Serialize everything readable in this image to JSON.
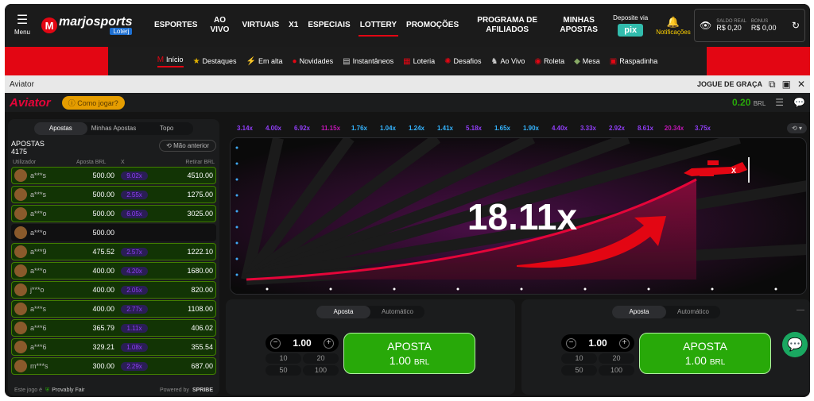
{
  "header": {
    "menu_label": "Menu",
    "logo_text": "marjosports",
    "logo_sub": "Loterj",
    "nav": [
      {
        "label": "ESPORTES"
      },
      {
        "label": "AO VIVO"
      },
      {
        "label": "VIRTUAIS"
      },
      {
        "label": "X1"
      },
      {
        "label": "ESPECIAIS"
      },
      {
        "label": "LOTTERY"
      },
      {
        "label": "PROMOÇÕES"
      },
      {
        "label": "PROGRAMA DE AFILIADOS"
      },
      {
        "label": "MINHAS APOSTAS"
      }
    ],
    "deposit_label": "Deposite via",
    "deposit_method": "pix",
    "notifications_label": "Notificações",
    "balance": {
      "real_label": "SALDO REAL",
      "real_value": "R$ 0,20",
      "bonus_label": "BONUS",
      "bonus_value": "R$ 0,00"
    }
  },
  "subnav": [
    {
      "label": "Início",
      "icon": "M"
    },
    {
      "label": "Destaques",
      "icon": "★"
    },
    {
      "label": "Em alta",
      "icon": "⚡"
    },
    {
      "label": "Novidades",
      "icon": "●"
    },
    {
      "label": "Instantâneos",
      "icon": "▤"
    },
    {
      "label": "Loteria",
      "icon": "▦"
    },
    {
      "label": "Desafios",
      "icon": "✺"
    },
    {
      "label": "Ao Vivo",
      "icon": "♞"
    },
    {
      "label": "Roleta",
      "icon": "◉"
    },
    {
      "label": "Mesa",
      "icon": "◆"
    },
    {
      "label": "Raspadinha",
      "icon": "▣"
    }
  ],
  "game_title": "Aviator",
  "play_free": "JOGUE DE GRAÇA",
  "game": {
    "logo": "Aviator",
    "how_to": "Como jogar?",
    "balance": "0.20",
    "currency": "BRL"
  },
  "bets": {
    "tabs": [
      "Apostas",
      "Minhas Apostas",
      "Topo"
    ],
    "title": "APOSTAS",
    "count": "4175",
    "prev_hand": "Mão anterior",
    "columns": [
      "Utilizador",
      "Aposta BRL",
      "X",
      "Retirar BRL"
    ],
    "rows": [
      {
        "user": "a***s",
        "bet": "500.00",
        "mult": "9.02x",
        "win": "4510.00",
        "won": true
      },
      {
        "user": "a***s",
        "bet": "500.00",
        "mult": "2.55x",
        "win": "1275.00",
        "won": true
      },
      {
        "user": "a***o",
        "bet": "500.00",
        "mult": "6.05x",
        "win": "3025.00",
        "won": true
      },
      {
        "user": "a***o",
        "bet": "500.00",
        "mult": "",
        "win": "",
        "won": false
      },
      {
        "user": "a***9",
        "bet": "475.52",
        "mult": "2.57x",
        "win": "1222.10",
        "won": true
      },
      {
        "user": "a***o",
        "bet": "400.00",
        "mult": "4.20x",
        "win": "1680.00",
        "won": true
      },
      {
        "user": "j***o",
        "bet": "400.00",
        "mult": "2.05x",
        "win": "820.00",
        "won": true
      },
      {
        "user": "a***s",
        "bet": "400.00",
        "mult": "2.77x",
        "win": "1108.00",
        "won": true
      },
      {
        "user": "a***6",
        "bet": "365.79",
        "mult": "1.11x",
        "win": "406.02",
        "won": true
      },
      {
        "user": "a***6",
        "bet": "329.21",
        "mult": "1.08x",
        "win": "355.54",
        "won": true
      },
      {
        "user": "m***s",
        "bet": "300.00",
        "mult": "2.29x",
        "win": "687.00",
        "won": true
      }
    ],
    "footer_left": "Este jogo é",
    "provably_fair": "Provably Fair",
    "powered_by": "Powered by",
    "spribe": "SPRIBE"
  },
  "history": [
    "3.14x",
    "4.00x",
    "6.92x",
    "11.15x",
    "1.76x",
    "1.04x",
    "1.24x",
    "1.41x",
    "5.18x",
    "1.65x",
    "1.90x",
    "4.40x",
    "3.33x",
    "2.92x",
    "8.61x",
    "20.34x",
    "3.75x"
  ],
  "current_multiplier": "18.11x",
  "bet_panels": [
    {
      "tabs": [
        "Aposta",
        "Automático"
      ],
      "stake": "1.00",
      "quick": [
        "10",
        "20",
        "50",
        "100"
      ],
      "btn_label": "APOSTA",
      "btn_amount": "1.00",
      "btn_currency": "BRL"
    },
    {
      "tabs": [
        "Aposta",
        "Automático"
      ],
      "stake": "1.00",
      "quick": [
        "10",
        "20",
        "50",
        "100"
      ],
      "btn_label": "APOSTA",
      "btn_amount": "1.00",
      "btn_currency": "BRL"
    }
  ],
  "colors": {
    "brand_red": "#e30613",
    "win_green": "#28a909",
    "mult_purple": "#913ef8",
    "mult_blue": "#34b4ff",
    "mult_pink": "#c017b4"
  }
}
